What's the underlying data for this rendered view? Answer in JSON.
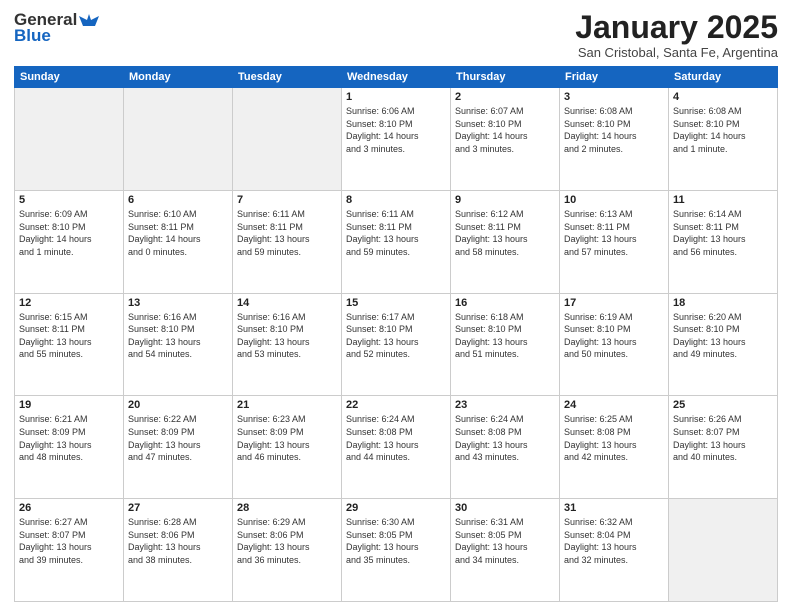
{
  "header": {
    "logo_line1": "General",
    "logo_line2": "Blue",
    "title": "January 2025",
    "subtitle": "San Cristobal, Santa Fe, Argentina"
  },
  "weekdays": [
    "Sunday",
    "Monday",
    "Tuesday",
    "Wednesday",
    "Thursday",
    "Friday",
    "Saturday"
  ],
  "weeks": [
    [
      {
        "day": "",
        "info": "",
        "empty": true
      },
      {
        "day": "",
        "info": "",
        "empty": true
      },
      {
        "day": "",
        "info": "",
        "empty": true
      },
      {
        "day": "1",
        "info": "Sunrise: 6:06 AM\nSunset: 8:10 PM\nDaylight: 14 hours\nand 3 minutes.",
        "empty": false
      },
      {
        "day": "2",
        "info": "Sunrise: 6:07 AM\nSunset: 8:10 PM\nDaylight: 14 hours\nand 3 minutes.",
        "empty": false
      },
      {
        "day": "3",
        "info": "Sunrise: 6:08 AM\nSunset: 8:10 PM\nDaylight: 14 hours\nand 2 minutes.",
        "empty": false
      },
      {
        "day": "4",
        "info": "Sunrise: 6:08 AM\nSunset: 8:10 PM\nDaylight: 14 hours\nand 1 minute.",
        "empty": false
      }
    ],
    [
      {
        "day": "5",
        "info": "Sunrise: 6:09 AM\nSunset: 8:10 PM\nDaylight: 14 hours\nand 1 minute.",
        "empty": false
      },
      {
        "day": "6",
        "info": "Sunrise: 6:10 AM\nSunset: 8:11 PM\nDaylight: 14 hours\nand 0 minutes.",
        "empty": false
      },
      {
        "day": "7",
        "info": "Sunrise: 6:11 AM\nSunset: 8:11 PM\nDaylight: 13 hours\nand 59 minutes.",
        "empty": false
      },
      {
        "day": "8",
        "info": "Sunrise: 6:11 AM\nSunset: 8:11 PM\nDaylight: 13 hours\nand 59 minutes.",
        "empty": false
      },
      {
        "day": "9",
        "info": "Sunrise: 6:12 AM\nSunset: 8:11 PM\nDaylight: 13 hours\nand 58 minutes.",
        "empty": false
      },
      {
        "day": "10",
        "info": "Sunrise: 6:13 AM\nSunset: 8:11 PM\nDaylight: 13 hours\nand 57 minutes.",
        "empty": false
      },
      {
        "day": "11",
        "info": "Sunrise: 6:14 AM\nSunset: 8:11 PM\nDaylight: 13 hours\nand 56 minutes.",
        "empty": false
      }
    ],
    [
      {
        "day": "12",
        "info": "Sunrise: 6:15 AM\nSunset: 8:11 PM\nDaylight: 13 hours\nand 55 minutes.",
        "empty": false
      },
      {
        "day": "13",
        "info": "Sunrise: 6:16 AM\nSunset: 8:10 PM\nDaylight: 13 hours\nand 54 minutes.",
        "empty": false
      },
      {
        "day": "14",
        "info": "Sunrise: 6:16 AM\nSunset: 8:10 PM\nDaylight: 13 hours\nand 53 minutes.",
        "empty": false
      },
      {
        "day": "15",
        "info": "Sunrise: 6:17 AM\nSunset: 8:10 PM\nDaylight: 13 hours\nand 52 minutes.",
        "empty": false
      },
      {
        "day": "16",
        "info": "Sunrise: 6:18 AM\nSunset: 8:10 PM\nDaylight: 13 hours\nand 51 minutes.",
        "empty": false
      },
      {
        "day": "17",
        "info": "Sunrise: 6:19 AM\nSunset: 8:10 PM\nDaylight: 13 hours\nand 50 minutes.",
        "empty": false
      },
      {
        "day": "18",
        "info": "Sunrise: 6:20 AM\nSunset: 8:10 PM\nDaylight: 13 hours\nand 49 minutes.",
        "empty": false
      }
    ],
    [
      {
        "day": "19",
        "info": "Sunrise: 6:21 AM\nSunset: 8:09 PM\nDaylight: 13 hours\nand 48 minutes.",
        "empty": false
      },
      {
        "day": "20",
        "info": "Sunrise: 6:22 AM\nSunset: 8:09 PM\nDaylight: 13 hours\nand 47 minutes.",
        "empty": false
      },
      {
        "day": "21",
        "info": "Sunrise: 6:23 AM\nSunset: 8:09 PM\nDaylight: 13 hours\nand 46 minutes.",
        "empty": false
      },
      {
        "day": "22",
        "info": "Sunrise: 6:24 AM\nSunset: 8:08 PM\nDaylight: 13 hours\nand 44 minutes.",
        "empty": false
      },
      {
        "day": "23",
        "info": "Sunrise: 6:24 AM\nSunset: 8:08 PM\nDaylight: 13 hours\nand 43 minutes.",
        "empty": false
      },
      {
        "day": "24",
        "info": "Sunrise: 6:25 AM\nSunset: 8:08 PM\nDaylight: 13 hours\nand 42 minutes.",
        "empty": false
      },
      {
        "day": "25",
        "info": "Sunrise: 6:26 AM\nSunset: 8:07 PM\nDaylight: 13 hours\nand 40 minutes.",
        "empty": false
      }
    ],
    [
      {
        "day": "26",
        "info": "Sunrise: 6:27 AM\nSunset: 8:07 PM\nDaylight: 13 hours\nand 39 minutes.",
        "empty": false
      },
      {
        "day": "27",
        "info": "Sunrise: 6:28 AM\nSunset: 8:06 PM\nDaylight: 13 hours\nand 38 minutes.",
        "empty": false
      },
      {
        "day": "28",
        "info": "Sunrise: 6:29 AM\nSunset: 8:06 PM\nDaylight: 13 hours\nand 36 minutes.",
        "empty": false
      },
      {
        "day": "29",
        "info": "Sunrise: 6:30 AM\nSunset: 8:05 PM\nDaylight: 13 hours\nand 35 minutes.",
        "empty": false
      },
      {
        "day": "30",
        "info": "Sunrise: 6:31 AM\nSunset: 8:05 PM\nDaylight: 13 hours\nand 34 minutes.",
        "empty": false
      },
      {
        "day": "31",
        "info": "Sunrise: 6:32 AM\nSunset: 8:04 PM\nDaylight: 13 hours\nand 32 minutes.",
        "empty": false
      },
      {
        "day": "",
        "info": "",
        "empty": true
      }
    ]
  ]
}
